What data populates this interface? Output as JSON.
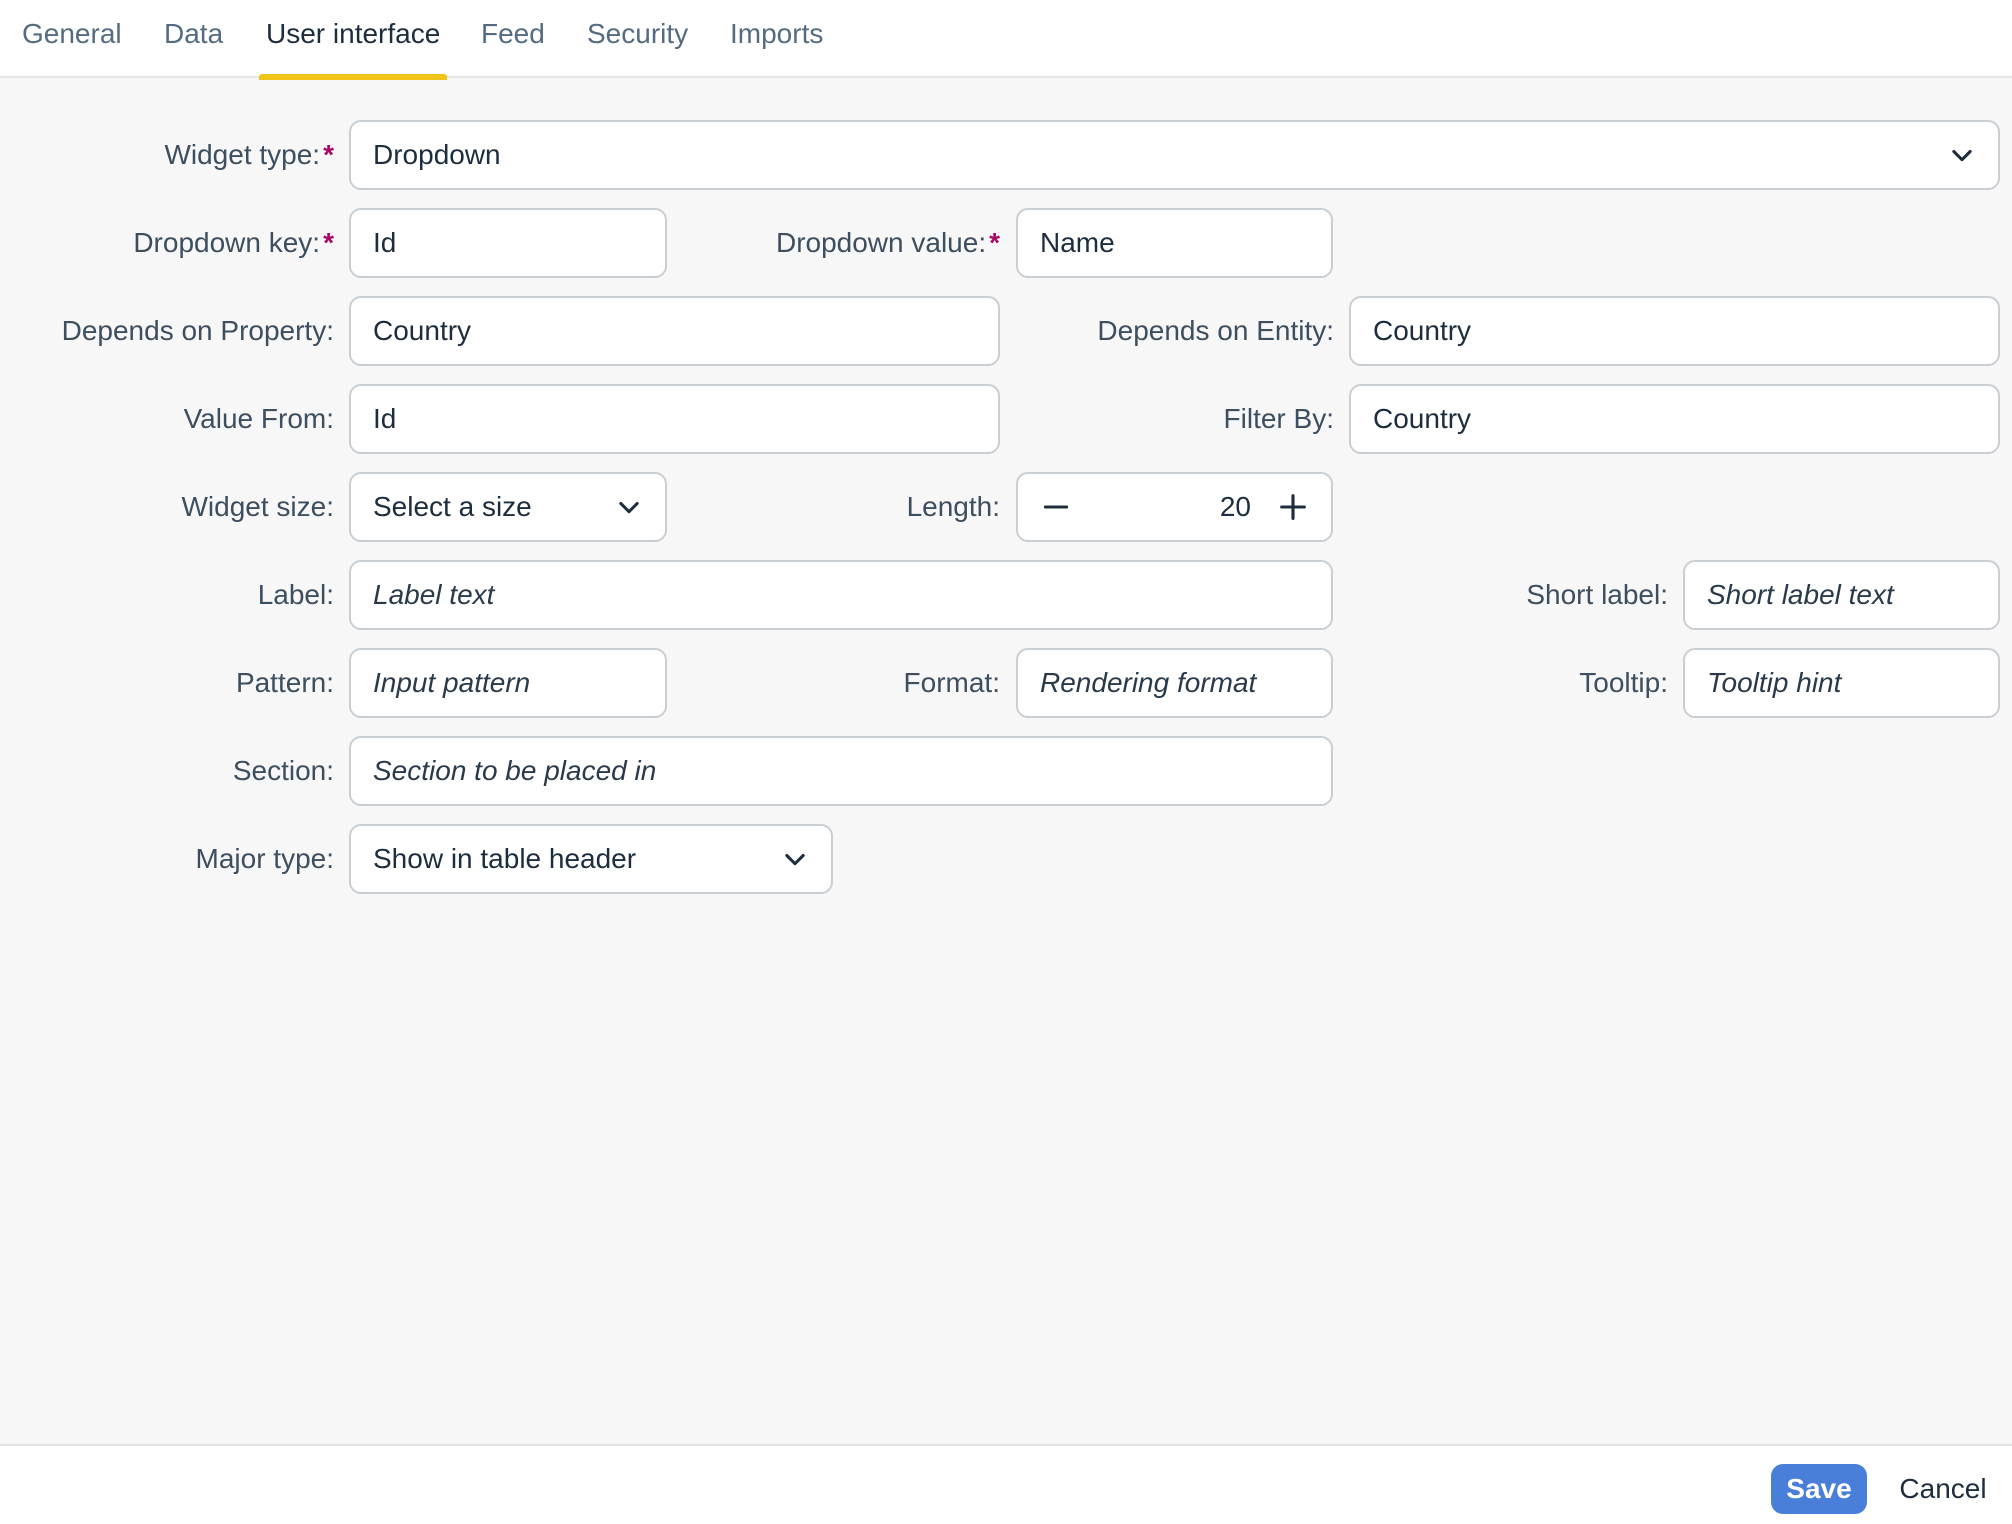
{
  "tabs": [
    {
      "label": "General"
    },
    {
      "label": "Data"
    },
    {
      "label": "User interface"
    },
    {
      "label": "Feed"
    },
    {
      "label": "Security"
    },
    {
      "label": "Imports"
    }
  ],
  "active_tab": "User interface",
  "form": {
    "widget_type": {
      "label": "Widget type:",
      "required_mark": "*",
      "value": "Dropdown"
    },
    "dropdown_key": {
      "label": "Dropdown key:",
      "required_mark": "*",
      "value": "Id"
    },
    "dropdown_value": {
      "label": "Dropdown value:",
      "required_mark": "*",
      "value": "Name"
    },
    "depends_on_property": {
      "label": "Depends on Property:",
      "value": "Country"
    },
    "depends_on_entity": {
      "label": "Depends on Entity:",
      "value": "Country"
    },
    "value_from": {
      "label": "Value From:",
      "value": "Id"
    },
    "filter_by": {
      "label": "Filter By:",
      "value": "Country"
    },
    "widget_size": {
      "label": "Widget size:",
      "value": "Select a size"
    },
    "length": {
      "label": "Length:",
      "value": "20"
    },
    "label_field": {
      "label": "Label:",
      "placeholder": "Label text"
    },
    "short_label": {
      "label": "Short label:",
      "placeholder": "Short label text"
    },
    "pattern": {
      "label": "Pattern:",
      "placeholder": "Input pattern"
    },
    "format": {
      "label": "Format:",
      "placeholder": "Rendering format"
    },
    "tooltip": {
      "label": "Tooltip:",
      "placeholder": "Tooltip hint"
    },
    "section": {
      "label": "Section:",
      "placeholder": "Section to be placed in"
    },
    "major_type": {
      "label": "Major type:",
      "value": "Show in table header"
    }
  },
  "footer": {
    "save_label": "Save",
    "cancel_label": "Cancel"
  },
  "icons": {
    "select": "chevron-down-icon",
    "decrement": "minus-icon",
    "increment": "plus-icon"
  },
  "colors": {
    "active_tab_indicator": "#f0c419",
    "required_mark": "#aa0867",
    "save_button": "#4a7fd9"
  }
}
